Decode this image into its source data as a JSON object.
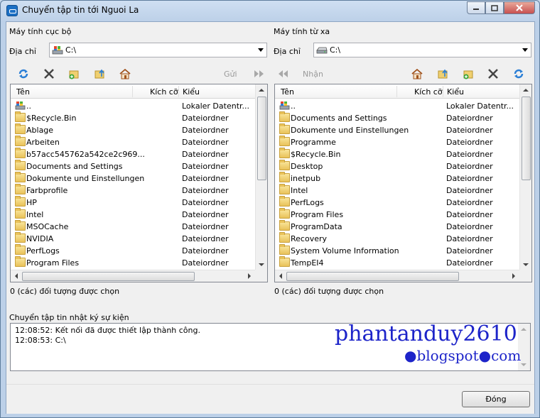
{
  "window": {
    "title": "Chuyển tập tin tới Nguoi La"
  },
  "local": {
    "header": "Máy tính cục bộ",
    "address_label": "Địa chỉ",
    "address_value": "C:\\",
    "toolbar": {
      "send_label": "Gửi"
    },
    "columns": {
      "name": "Tên",
      "size": "Kích cỡ",
      "type": "Kiểu"
    },
    "rows": [
      {
        "name": "..",
        "type": "Lokaler Datentr...",
        "icon": "computer-icon"
      },
      {
        "name": "$Recycle.Bin",
        "type": "Dateiordner",
        "icon": "folder-icon"
      },
      {
        "name": "Ablage",
        "type": "Dateiordner",
        "icon": "folder-icon"
      },
      {
        "name": "Arbeiten",
        "type": "Dateiordner",
        "icon": "folder-icon"
      },
      {
        "name": "b57acc545762a542ce2c969...",
        "type": "Dateiordner",
        "icon": "folder-icon"
      },
      {
        "name": "Documents and Settings",
        "type": "Dateiordner",
        "icon": "folder-icon"
      },
      {
        "name": "Dokumente und Einstellungen",
        "type": "Dateiordner",
        "icon": "folder-icon"
      },
      {
        "name": "Farbprofile",
        "type": "Dateiordner",
        "icon": "folder-icon"
      },
      {
        "name": "HP",
        "type": "Dateiordner",
        "icon": "folder-icon"
      },
      {
        "name": "Intel",
        "type": "Dateiordner",
        "icon": "folder-icon"
      },
      {
        "name": "MSOCache",
        "type": "Dateiordner",
        "icon": "folder-icon"
      },
      {
        "name": "NVIDIA",
        "type": "Dateiordner",
        "icon": "folder-icon"
      },
      {
        "name": "PerfLogs",
        "type": "Dateiordner",
        "icon": "folder-icon"
      },
      {
        "name": "Program Files",
        "type": "Dateiordner",
        "icon": "folder-icon"
      }
    ],
    "status": "0 (các) đối tượng được chọn"
  },
  "remote": {
    "header": "Máy tính từ xa",
    "address_label": "Địa chỉ",
    "address_value": "C:\\",
    "toolbar": {
      "receive_label": "Nhận"
    },
    "columns": {
      "name": "Tên",
      "size": "Kích cỡ",
      "type": "Kiểu"
    },
    "rows": [
      {
        "name": "..",
        "type": "Lokaler Datentr...",
        "icon": "computer-icon"
      },
      {
        "name": "Documents and Settings",
        "type": "Dateiordner",
        "icon": "folder-icon"
      },
      {
        "name": "Dokumente und Einstellungen",
        "type": "Dateiordner",
        "icon": "folder-icon"
      },
      {
        "name": "Programme",
        "type": "Dateiordner",
        "icon": "folder-icon"
      },
      {
        "name": "$Recycle.Bin",
        "type": "Dateiordner",
        "icon": "folder-icon"
      },
      {
        "name": "Desktop",
        "type": "Dateiordner",
        "icon": "folder-icon"
      },
      {
        "name": "inetpub",
        "type": "Dateiordner",
        "icon": "folder-icon"
      },
      {
        "name": "Intel",
        "type": "Dateiordner",
        "icon": "folder-icon"
      },
      {
        "name": "PerfLogs",
        "type": "Dateiordner",
        "icon": "folder-icon"
      },
      {
        "name": "Program Files",
        "type": "Dateiordner",
        "icon": "folder-icon"
      },
      {
        "name": "ProgramData",
        "type": "Dateiordner",
        "icon": "folder-icon"
      },
      {
        "name": "Recovery",
        "type": "Dateiordner",
        "icon": "folder-icon"
      },
      {
        "name": "System Volume Information",
        "type": "Dateiordner",
        "icon": "folder-icon"
      },
      {
        "name": "TempEI4",
        "type": "Dateiordner",
        "icon": "folder-icon"
      }
    ],
    "status": "0 (các) đối tượng được chọn"
  },
  "log": {
    "header": "Chuyển tập tin nhật ký sự kiện",
    "lines": [
      "12:08:52: Kết nối đã được thiết lập thành công.",
      "12:08:53: C:\\"
    ]
  },
  "watermark": {
    "line1": "phantanduy2610",
    "line2": "●blogspot●com"
  },
  "buttons": {
    "close_label": "Đóng"
  },
  "colors": {
    "accent": "#1b6fc4",
    "folder": "#e9c25a",
    "watermark": "#1d24c9",
    "disabled_text": "#9a9a9a"
  }
}
